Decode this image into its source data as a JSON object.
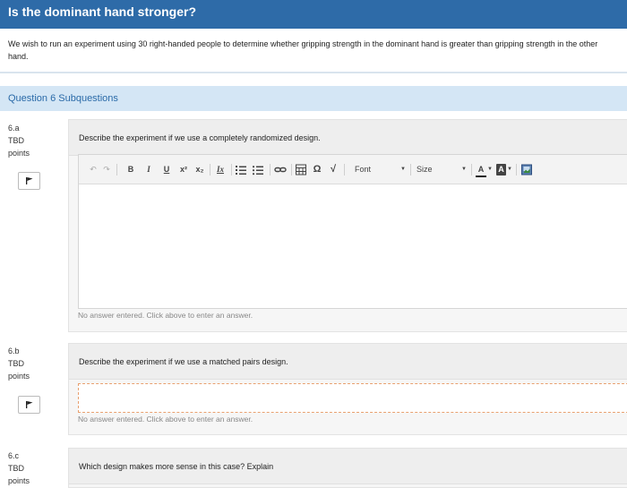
{
  "header": {
    "title": "Is the dominant hand stronger?"
  },
  "intro": {
    "text": "We wish to run an experiment using 30 right-handed people to determine whether gripping strength in the dominant hand is greater than gripping strength in the other hand."
  },
  "subquestions_title": "Question 6 Subquestions",
  "questions": [
    {
      "id": "6.a",
      "points_label": "TBD",
      "points_unit": "points",
      "prompt": "Describe the experiment if we use a completely randomized design.",
      "answer_status": "No answer entered. Click above to enter an answer."
    },
    {
      "id": "6.b",
      "points_label": "TBD",
      "points_unit": "points",
      "prompt": "Describe the experiment if we use a matched pairs design.",
      "answer_status": "No answer entered. Click above to enter an answer."
    },
    {
      "id": "6.c",
      "points_label": "TBD",
      "points_unit": "points",
      "prompt": "Which design makes more sense in this case? Explain"
    }
  ],
  "toolbar": {
    "undo": "↶",
    "redo": "↷",
    "bold": "B",
    "italic": "I",
    "underline": "U",
    "superscript": "x²",
    "subscript": "x₂",
    "clear_format": "Ix",
    "font_label": "Font",
    "size_label": "Size",
    "font_color": "A",
    "bg_color": "A"
  }
}
